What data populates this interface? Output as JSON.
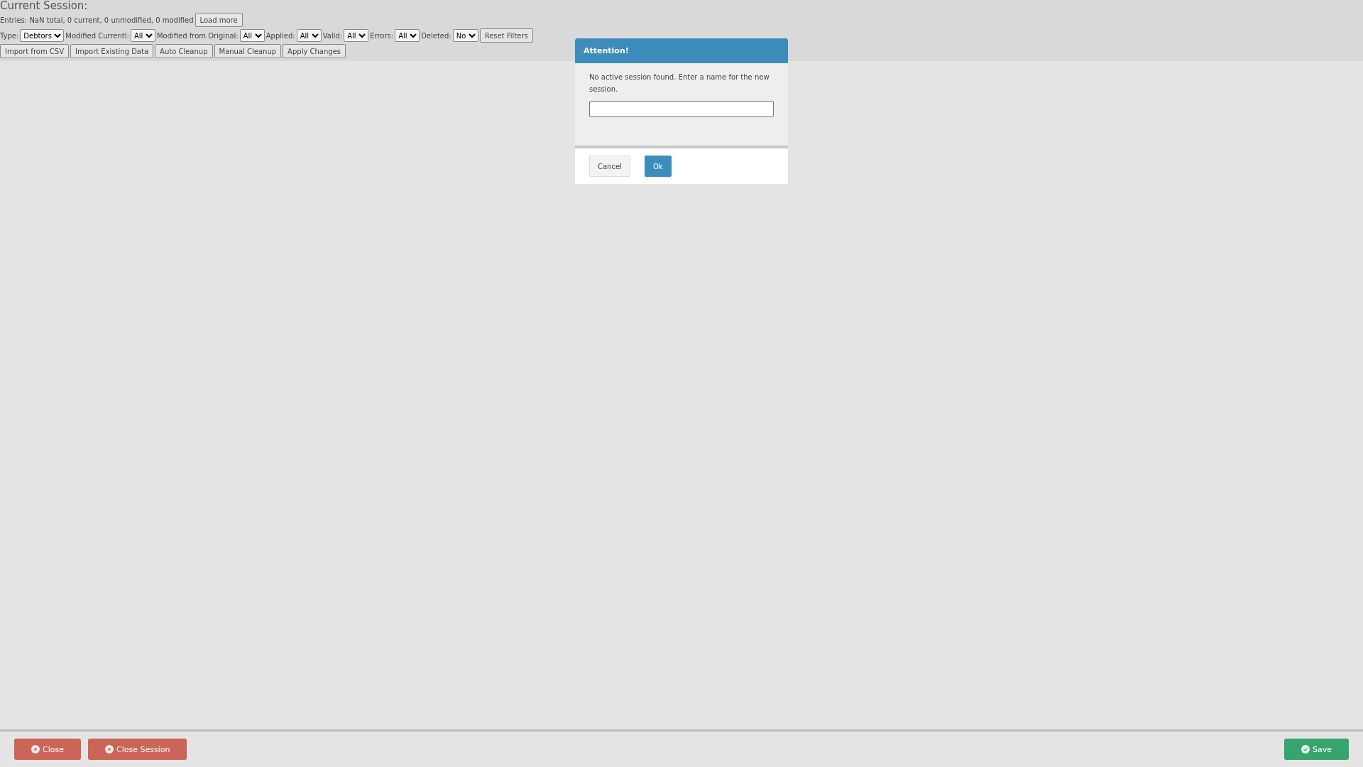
{
  "session": {
    "title": "Current Session:",
    "entries": "Entries: NaN total, 0 current, 0 unmodified, 0 modified",
    "load_more": "Load more"
  },
  "filters": [
    {
      "label": "Type:",
      "value": "Debtors"
    },
    {
      "label": "Modified Currentl:",
      "value": "All"
    },
    {
      "label": "Modified from Original:",
      "value": "All"
    },
    {
      "label": "Applied:",
      "value": "All"
    },
    {
      "label": "Valid:",
      "value": "All"
    },
    {
      "label": "Errors:",
      "value": "All"
    },
    {
      "label": "Deleted:",
      "value": "No"
    }
  ],
  "reset_filters": "Reset Filters",
  "actions": [
    "Import from CSV",
    "Import Existing Data",
    "Auto Cleanup",
    "Manual Cleanup",
    "Apply Changes"
  ],
  "dialog": {
    "title": "Attention!",
    "message": "No active session found. Enter a name for the new session.",
    "buttons": [
      {
        "label": "Cancel",
        "kind": "default"
      },
      {
        "label": "Ok",
        "kind": "primary"
      }
    ]
  },
  "footer": {
    "left": [
      {
        "label": "Close",
        "kind": "close"
      },
      {
        "label": "Close Session",
        "kind": "close"
      }
    ],
    "right": [
      {
        "label": "Save",
        "kind": "save"
      }
    ]
  }
}
